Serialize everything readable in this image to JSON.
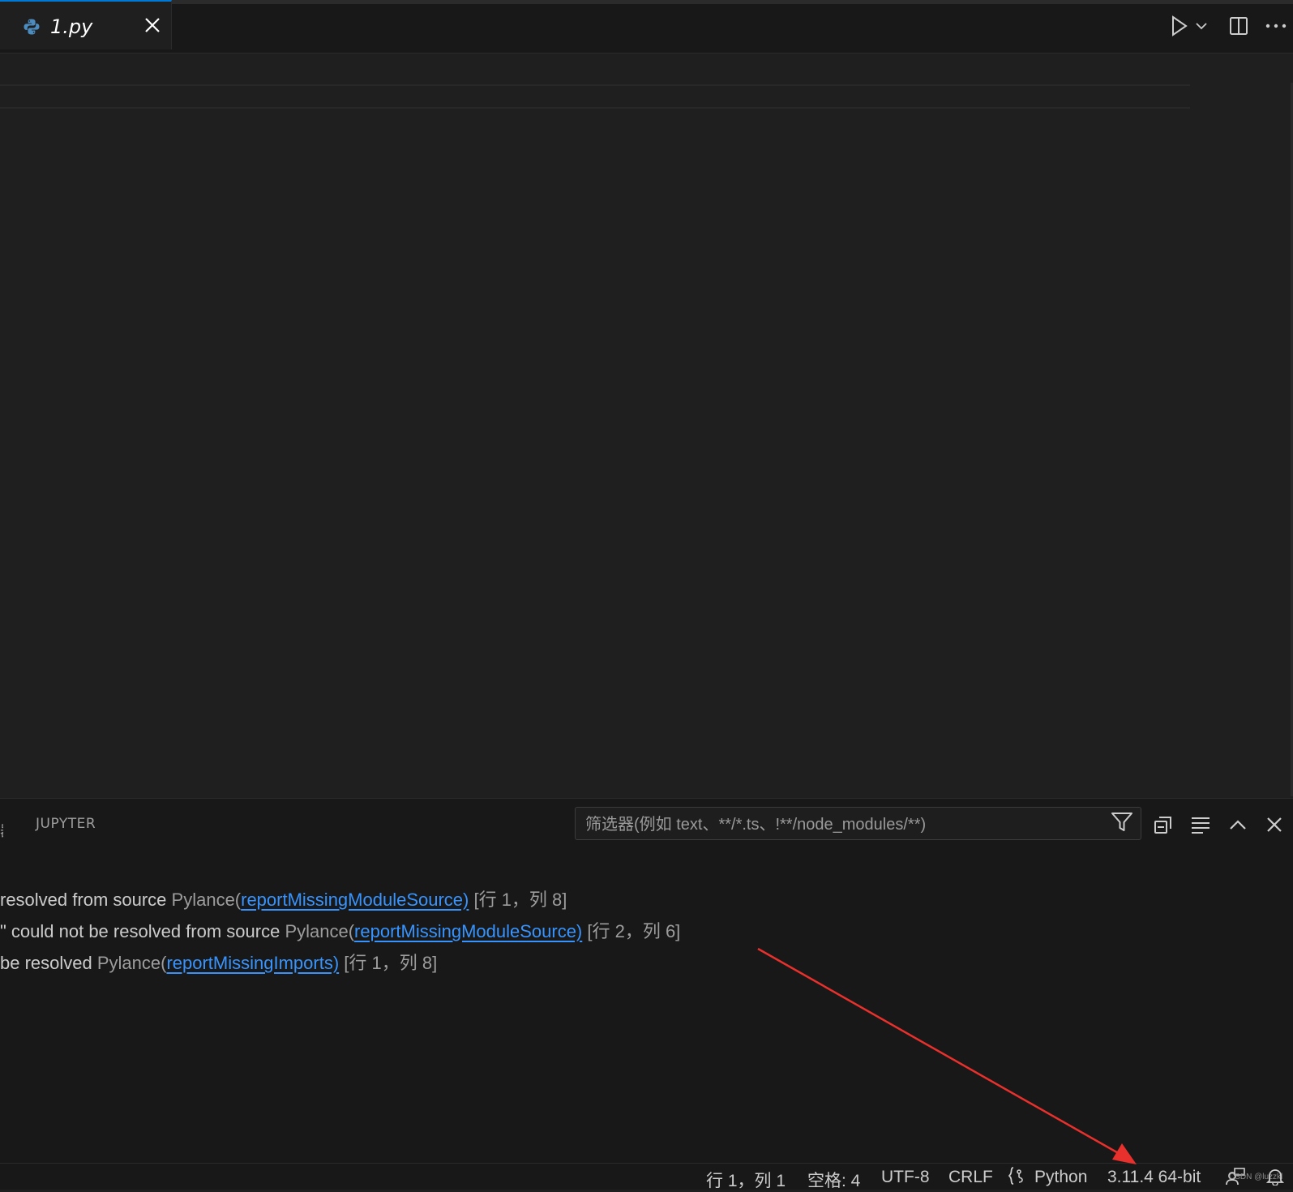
{
  "tab": {
    "label": "1.py",
    "icon": "python-icon",
    "accent": "#0078d4"
  },
  "toolbar": {
    "run_icon": "play-icon",
    "dropdown_icon": "chevron-down-icon",
    "split_icon": "split-editor-icon",
    "more_icon": "ellipsis-icon"
  },
  "panel": {
    "partial_tab": "器",
    "jupyter_tab": "JUPYTER",
    "filter_placeholder": "筛选器(例如 text、**/*.ts、!**/node_modules/**)",
    "problems": [
      {
        "message": " resolved from source ",
        "source": "Pylance(",
        "code": "reportMissingModuleSource)",
        "position": " [行 1，列 8]"
      },
      {
        "message": "\" could not be resolved from source ",
        "source": "Pylance(",
        "code": "reportMissingModuleSource)",
        "position": " [行 2，列 6]"
      },
      {
        "message": "be resolved ",
        "source": "Pylance(",
        "code": "reportMissingImports)",
        "position": " [行 1，列 8]"
      }
    ]
  },
  "statusbar": {
    "position": "行 1，列 1",
    "indent": "空格: 4",
    "encoding": "UTF-8",
    "eol": "CRLF",
    "language": "Python",
    "interpreter": "3.11.4 64-bit",
    "watermark": "CSDN @luzzkl"
  },
  "colors": {
    "link": "#3794ff",
    "annotation_arrow": "#e8302c",
    "python_blue": "#3572a5"
  }
}
